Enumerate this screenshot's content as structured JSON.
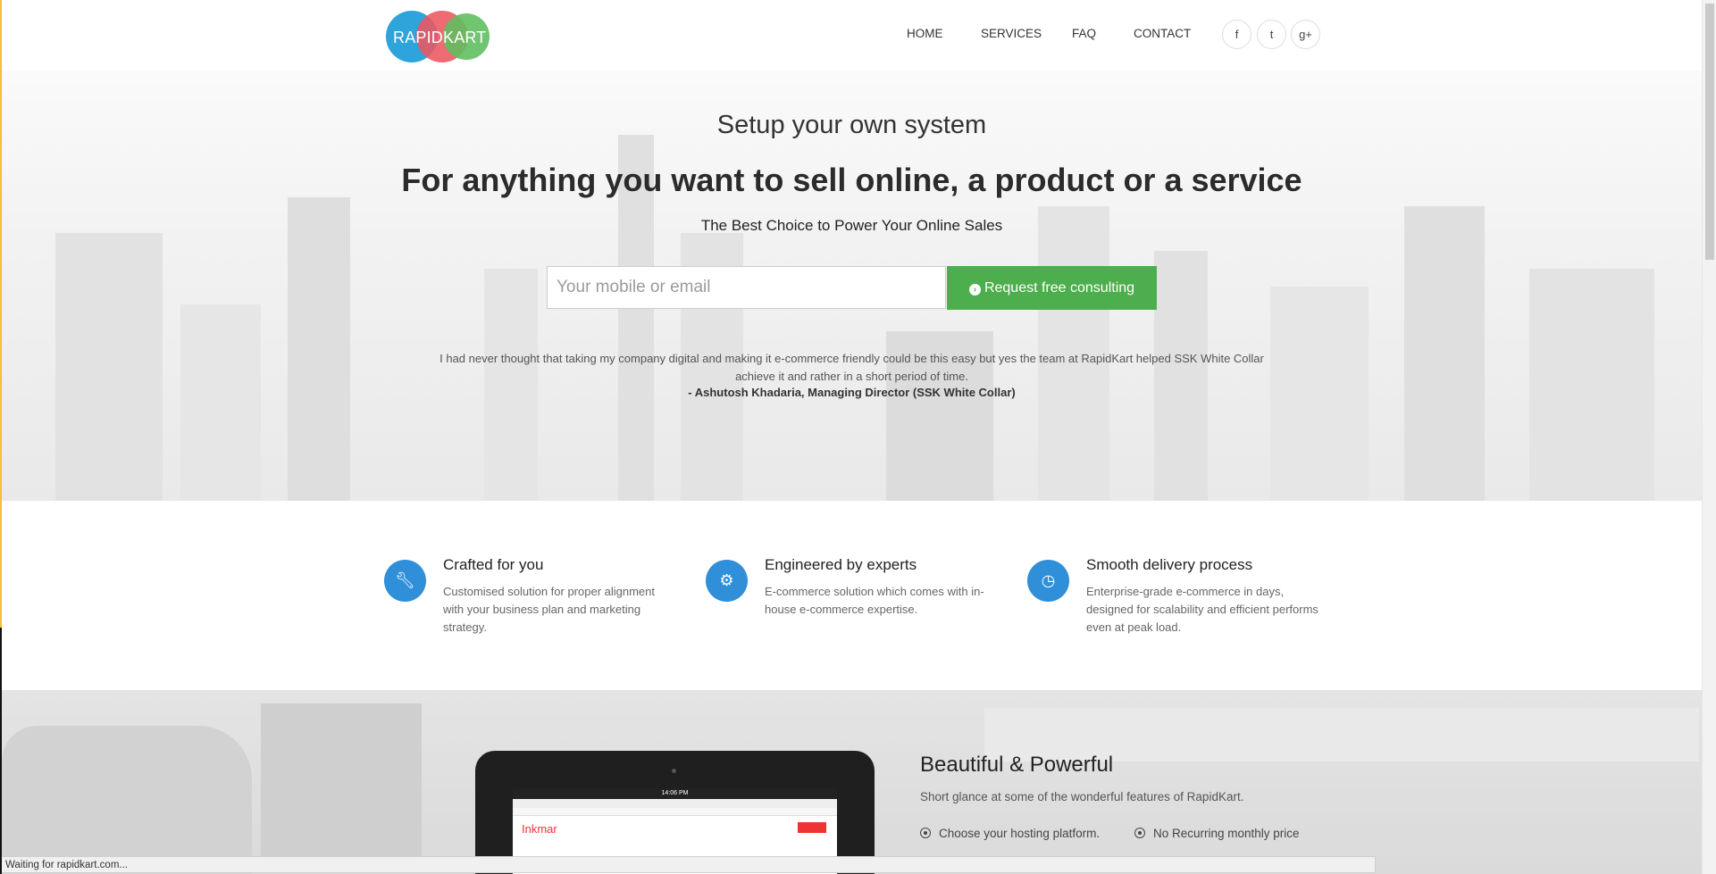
{
  "header": {
    "logo_text": "RAPIDKART",
    "nav": [
      "HOME",
      "SERVICES",
      "FAQ",
      "CONTACT"
    ],
    "social": [
      "f",
      "t",
      "g+"
    ]
  },
  "hero": {
    "subtitle": "Setup your own system",
    "title": "For anything you want to sell online, a product or a service",
    "tagline": "The Best Choice to Power Your Online Sales",
    "input_placeholder": "Your mobile or email",
    "button_label": "Request free consulting",
    "quote": "I had never thought that taking my company digital and making it e-commerce friendly could be this easy but yes the team at RapidKart helped SSK White Collar achieve it and rather in a short period of time.",
    "quote_author": "- Ashutosh Khadaria, Managing Director (SSK White Collar)"
  },
  "features": [
    {
      "icon": "wrench-icon",
      "title": "Crafted for you",
      "text": "Customised solution for proper alignment with your business plan and marketing strategy."
    },
    {
      "icon": "gears-icon",
      "title": "Engineered by experts",
      "text": "E-commerce solution which comes with in-house e-commerce expertise."
    },
    {
      "icon": "clock-icon",
      "title": "Smooth delivery process",
      "text": "Enterprise-grade e-commerce in days, designed for scalability and efficient performs even at peak load."
    }
  ],
  "bottom": {
    "title": "Beautiful & Powerful",
    "subtitle": "Short glance at some of the wonderful features of RapidKart.",
    "items": [
      "Choose your hosting platform.",
      "No Recurring monthly price"
    ],
    "tablet_time": "14:06 PM",
    "tablet_brand": "Inkmar"
  },
  "status": "Waiting for rapidkart.com..."
}
